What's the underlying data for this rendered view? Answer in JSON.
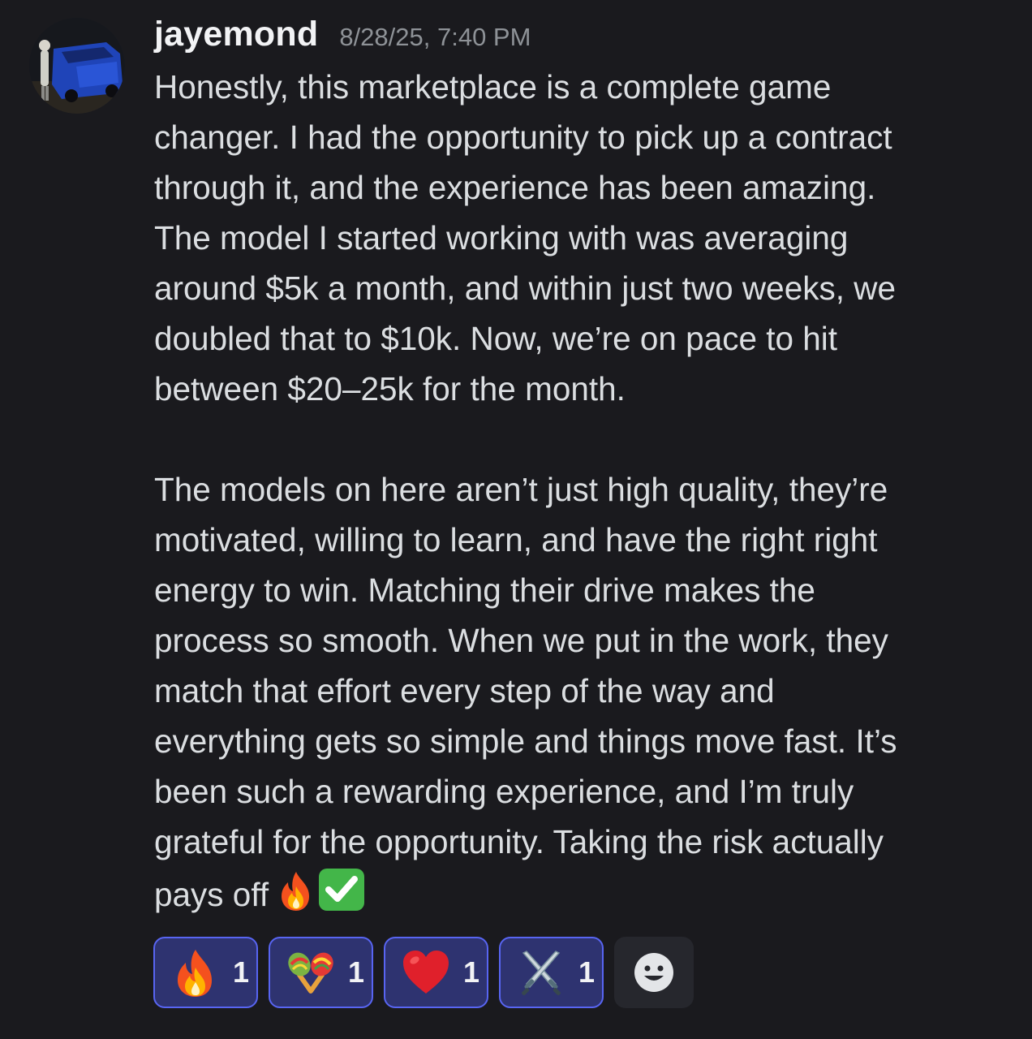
{
  "message": {
    "username": "jayemond",
    "timestamp": "8/28/25, 7:40 PM",
    "avatar_icon": "user-avatar-car-photo",
    "paragraph1": [
      "Honestly, this marketplace is a complete game",
      "changer. I had the opportunity to pick up a contract",
      "through it, and the experience has been amazing.",
      "The model I started working with was averaging",
      "around $5k a month, and within just two weeks, we",
      "doubled that to $10k. Now, we’re on pace to hit",
      "between $20–25k for the month."
    ],
    "paragraph2": [
      "The models on here aren’t just high quality, they’re",
      "motivated, willing to learn, and have the right right",
      "energy to win. Matching their drive makes the",
      "process so smooth. When we put in the work, they",
      "match that effort every step of the way and",
      "everything gets so simple and things move fast. It’s",
      "been such a rewarding experience, and I’m truly",
      "grateful for the opportunity. Taking the risk actually",
      "pays off"
    ],
    "trailing_emojis": [
      "fire-emoji",
      "check-mark-button-emoji"
    ]
  },
  "reactions": [
    {
      "emoji": "fire-emoji",
      "count": "1"
    },
    {
      "emoji": "maracas-emoji",
      "count": "1"
    },
    {
      "emoji": "red-heart-emoji",
      "count": "1"
    },
    {
      "emoji": "crossed-swords-emoji",
      "count": "1"
    }
  ],
  "add_reaction_icon": "smiley-add-reaction-icon",
  "colors": {
    "background": "#1a1a1e",
    "text": "#dbdee1",
    "username": "#f2f3f5",
    "timestamp": "#8e9297",
    "reaction_border": "#5865f2",
    "reaction_bg": "#2e3370"
  }
}
